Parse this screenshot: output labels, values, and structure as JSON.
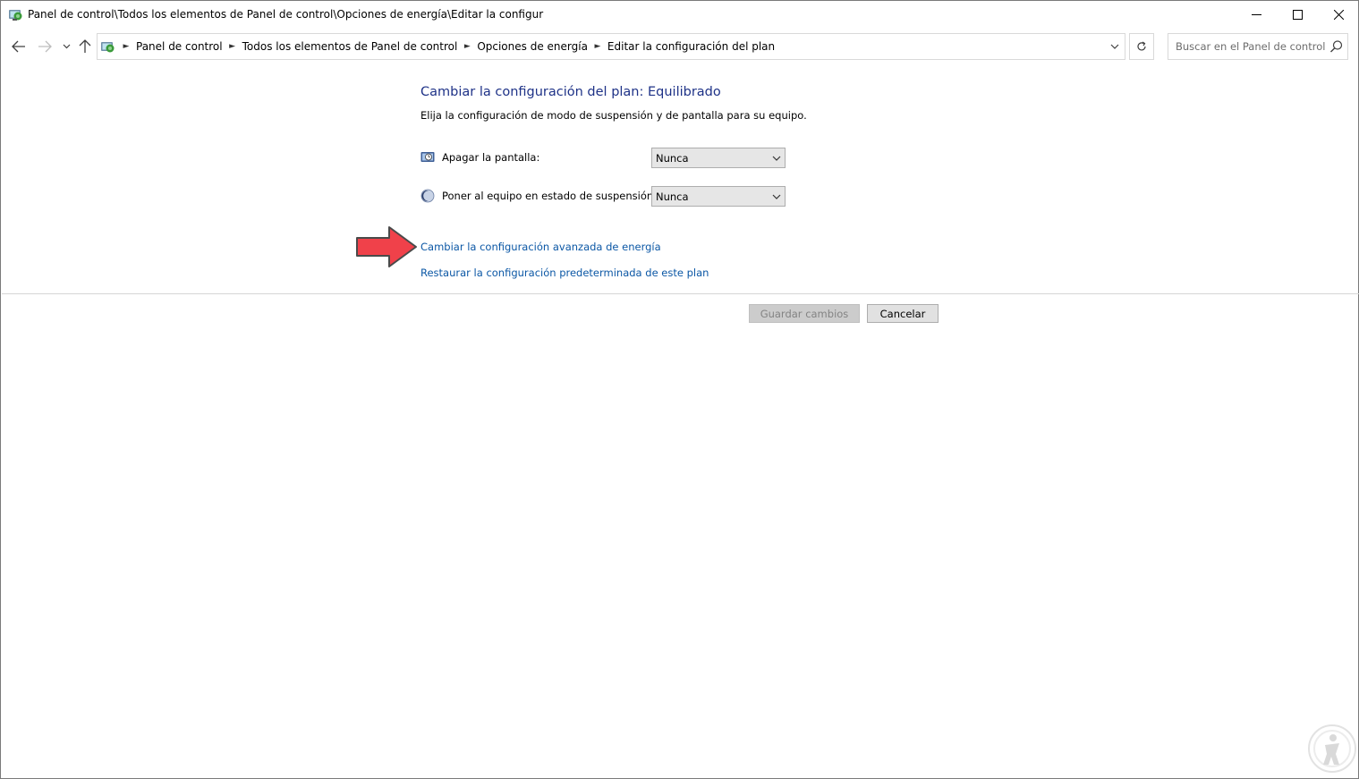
{
  "window": {
    "title": "Panel de control\\Todos los elementos de Panel de control\\Opciones de energía\\Editar la configur",
    "icon": "control-panel-icon",
    "controls": [
      "minimize-icon",
      "maximize-icon",
      "close-icon"
    ]
  },
  "nav": {
    "breadcrumbs": [
      "Panel de control",
      "Todos los elementos de Panel de control",
      "Opciones de energía",
      "Editar la configuración del plan"
    ],
    "search_placeholder": "Buscar en el Panel de control"
  },
  "main": {
    "heading": "Cambiar la configuración del plan: Equilibrado",
    "subtitle": "Elija la configuración de modo de suspensión y de pantalla para su equipo.",
    "settings": [
      {
        "label": "Apagar la pantalla:",
        "value": "Nunca",
        "icon": "monitor-icon"
      },
      {
        "label": "Poner al equipo en estado de suspensión:",
        "value": "Nunca",
        "icon": "moon-icon"
      }
    ],
    "links": [
      "Cambiar la configuración avanzada de energía",
      "Restaurar la configuración predeterminada de este plan"
    ],
    "buttons": {
      "save": "Guardar cambios",
      "cancel": "Cancelar"
    }
  },
  "colors": {
    "heading": "#1e3287",
    "link": "#0b57a5",
    "annotation_arrow": "#f0414a"
  }
}
